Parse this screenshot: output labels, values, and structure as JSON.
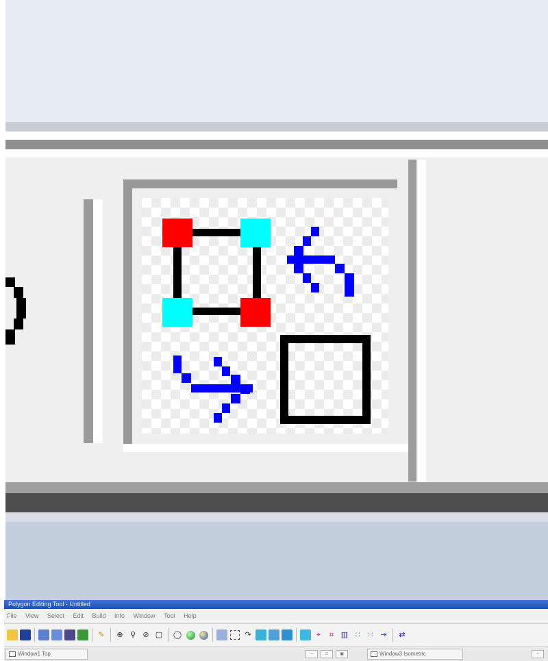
{
  "window": {
    "title": "Polygon Editing Tool - Untitled"
  },
  "menu": {
    "items": [
      "File",
      "View",
      "Select",
      "Edit",
      "Build",
      "Info",
      "Window",
      "Tool",
      "Help"
    ]
  },
  "toolbar": {
    "icons": [
      "open-folder-icon",
      "save-icon",
      "paint-icon",
      "transform-icon",
      "gear-icon",
      "shield-icon",
      "brush-icon",
      "zoom-in-icon",
      "search-icon",
      "zoom-icon",
      "select-zoom-icon",
      "circle-outline-icon",
      "green-sphere-icon",
      "color-sphere-icon",
      "paint-bucket-icon",
      "dashed-select-icon",
      "lasso-icon",
      "grid-icon",
      "grid-nodes-icon",
      "table-icon",
      "color-grid-icon",
      "vertex-move-icon",
      "vertex-icon",
      "split-icon",
      "dotted-grid-icon",
      "dashed-grid-icon",
      "arrow-right-icon",
      "swap-polygon-icon"
    ]
  },
  "statusbar": {
    "left_window": "Window1 Top",
    "right_window": "Window3 Isometric"
  },
  "zoomed_icon": {
    "name": "swap-polygon-icon",
    "colors": {
      "vertex_red": "#ff0000",
      "vertex_cyan": "#00ffff",
      "arrow_blue": "#0000ff",
      "edge_black": "#000000"
    }
  }
}
